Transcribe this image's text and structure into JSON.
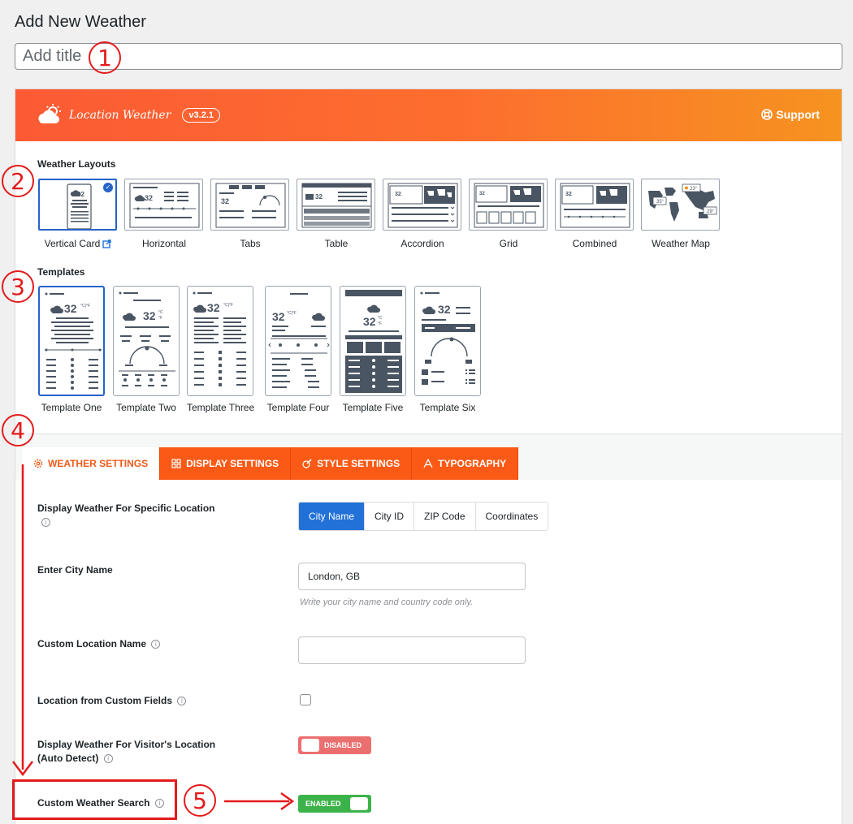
{
  "page": {
    "title": "Add New Weather"
  },
  "title_input": {
    "placeholder": "Add title"
  },
  "header": {
    "brand_name": "Location Weather",
    "version": "v3.2.1",
    "support_label": "Support"
  },
  "layouts": {
    "heading": "Weather Layouts",
    "items": [
      {
        "label": "Vertical Card",
        "selected": true,
        "icon": "external-link-icon"
      },
      {
        "label": "Horizontal"
      },
      {
        "label": "Tabs"
      },
      {
        "label": "Table"
      },
      {
        "label": "Accordion"
      },
      {
        "label": "Grid"
      },
      {
        "label": "Combined"
      },
      {
        "label": "Weather Map"
      }
    ]
  },
  "templates": {
    "heading": "Templates",
    "items": [
      {
        "label": "Template One",
        "selected": true
      },
      {
        "label": "Template Two"
      },
      {
        "label": "Template Three"
      },
      {
        "label": "Template Four"
      },
      {
        "label": "Template Five"
      },
      {
        "label": "Template Six"
      }
    ]
  },
  "thumb_text": {
    "temp": "32",
    "deg_cf": "°C|°F",
    "deg_c": "°C",
    "deg_f": "°F",
    "map_temp_1": "23°",
    "map_temp_2": "35°",
    "map_temp_3": "29°"
  },
  "tabs": [
    {
      "label": "WEATHER SETTINGS",
      "icon": "gear-icon",
      "active": true
    },
    {
      "label": "DISPLAY SETTINGS",
      "icon": "grid-icon"
    },
    {
      "label": "STYLE SETTINGS",
      "icon": "brush-icon"
    },
    {
      "label": "TYPOGRAPHY",
      "icon": "font-icon"
    }
  ],
  "settings": {
    "location_type": {
      "label": "Display Weather For Specific Location",
      "options": [
        "City Name",
        "City ID",
        "ZIP Code",
        "Coordinates"
      ],
      "selected": "City Name"
    },
    "city_name": {
      "label": "Enter City Name",
      "value": "London, GB",
      "help": "Write your city name and country code only."
    },
    "custom_location_name": {
      "label": "Custom Location Name",
      "value": ""
    },
    "location_custom_fields": {
      "label": "Location from Custom Fields",
      "checked": false
    },
    "visitor_location": {
      "label_line1": "Display Weather For Visitor's Location",
      "label_line2": "(Auto Detect)",
      "state": "DISABLED"
    },
    "custom_search": {
      "label": "Custom Weather Search",
      "state": "ENABLED"
    }
  },
  "annotations": [
    "1",
    "2",
    "3",
    "4",
    "5"
  ],
  "colors": {
    "accent_orange": "#fb5a16",
    "selected_blue": "#2271d8",
    "annotation_red": "#e31b1b",
    "toggle_on": "#3cb34a",
    "toggle_off": "#ec6f6f"
  }
}
